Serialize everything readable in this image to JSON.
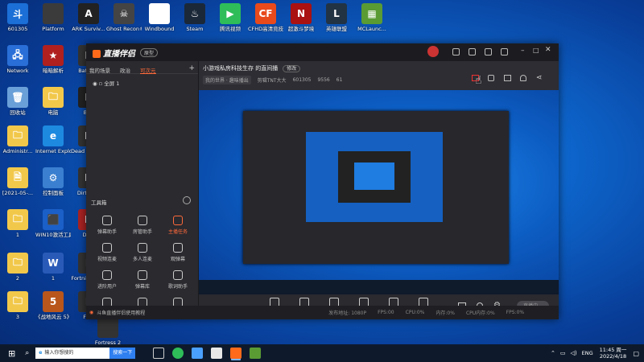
{
  "desktop_icons": [
    {
      "label": "601305",
      "glyph": "斗",
      "color": "#1b6fd6"
    },
    {
      "label": "Platform",
      "glyph": "",
      "color": "#3b3b3b"
    },
    {
      "label": "ARK Surviv...",
      "glyph": "A",
      "color": "#222222"
    },
    {
      "label": "Ghost Recon®...",
      "glyph": "☠",
      "color": "#444444"
    },
    {
      "label": "Windbound",
      "glyph": "◎",
      "color": "#ffffff"
    },
    {
      "label": "Steam",
      "glyph": "♨",
      "color": "#1b2838"
    },
    {
      "label": "腾讯视频",
      "glyph": "▶",
      "color": "#2ebd59"
    },
    {
      "label": "CFHD高清竞技大区",
      "glyph": "CF",
      "color": "#e84a1c"
    },
    {
      "label": "超激斗梦境",
      "glyph": "N",
      "color": "#aa1111"
    },
    {
      "label": "英雄联盟",
      "glyph": "L",
      "color": "#223344"
    },
    {
      "label": "MCLaunc...",
      "glyph": "▦",
      "color": "#5a9b34"
    },
    {
      "label": "Network",
      "glyph": "🖧",
      "color": "#2a6fd8"
    },
    {
      "label": "暗暗解析",
      "glyph": "★",
      "color": "#b0201f"
    },
    {
      "label": "Battle...",
      "glyph": "B",
      "color": "#333333"
    },
    {
      "label": "回收站",
      "glyph": "🗑",
      "color": "#6aa0d8"
    },
    {
      "label": "电脑",
      "glyph": "🗀",
      "color": "#f2c84b"
    },
    {
      "label": "Bl...",
      "glyph": "B",
      "color": "#222222"
    },
    {
      "label": "Administr...",
      "glyph": "🗀",
      "color": "#f2c84b"
    },
    {
      "label": "Internet Explorer",
      "glyph": "e",
      "color": "#1d8ae0"
    },
    {
      "label": "Dead Daylig...",
      "glyph": "D",
      "color": "#333333"
    },
    {
      "label": "[2021-05-...",
      "glyph": "🗎",
      "color": "#f2c84b"
    },
    {
      "label": "控制面板",
      "glyph": "⚙",
      "color": "#3a7fd0"
    },
    {
      "label": "Dirty E...",
      "glyph": "D",
      "color": "#333333"
    },
    {
      "label": "1",
      "glyph": "🗀",
      "color": "#f2c84b"
    },
    {
      "label": "WIN10激活工具",
      "glyph": "⬛",
      "color": "#1b5fc8"
    },
    {
      "label": "Do...",
      "glyph": "D",
      "color": "#aa2222"
    },
    {
      "label": "2",
      "glyph": "🗀",
      "color": "#f2c84b"
    },
    {
      "label": "1",
      "glyph": "W",
      "color": "#2a5ab8"
    },
    {
      "label": "Fortnite Fra...",
      "glyph": "F",
      "color": "#333333"
    },
    {
      "label": "3",
      "glyph": "🗀",
      "color": "#f2c84b"
    },
    {
      "label": "《战地风云 5》",
      "glyph": "5",
      "color": "#b8561c"
    },
    {
      "label": "Fo...",
      "glyph": "F",
      "color": "#333333"
    },
    {
      "label": "Fortress 2",
      "glyph": "",
      "color": "#333333"
    }
  ],
  "app": {
    "name": "直播伴侣",
    "badge": "原型",
    "left_tabs": [
      "我的场景",
      "政治",
      "可次元"
    ],
    "active_tab": "可次元",
    "scene_item": "全屏 1",
    "tools_heading": "工具箱",
    "tools": [
      "弹幕助手",
      "房管助手",
      "主播任务",
      "视频连麦",
      "多人连麦",
      "观弹幕",
      "进阶用户",
      "弹幕库",
      "歌词助手",
      "",
      "",
      ""
    ],
    "notice": "斗鱼直播伴侣使用教程",
    "room_title": "小游戏私房科技生存 的直间播",
    "edit_label": "修改",
    "room_info": [
      "我的世界 · 趣味播出",
      "剪辑TNT大大",
      "601305",
      "9556",
      "61"
    ],
    "controls": [
      "直播屏幕",
      "摄像头",
      "手机投屏",
      "多媒体",
      "麦克风",
      "扬声器"
    ],
    "golive": "直播中...",
    "status": [
      "发布地址: 1080P",
      "FPS:00",
      "CPU:0%",
      "内存:0%",
      "CPU内存:0%",
      "FPS:0%"
    ]
  },
  "taskbar": {
    "search_placeholder": "输入你想搜的",
    "search_button": "搜索一下",
    "lang": "ENG",
    "time": "11:45 周一",
    "date": "2022/4/18"
  }
}
